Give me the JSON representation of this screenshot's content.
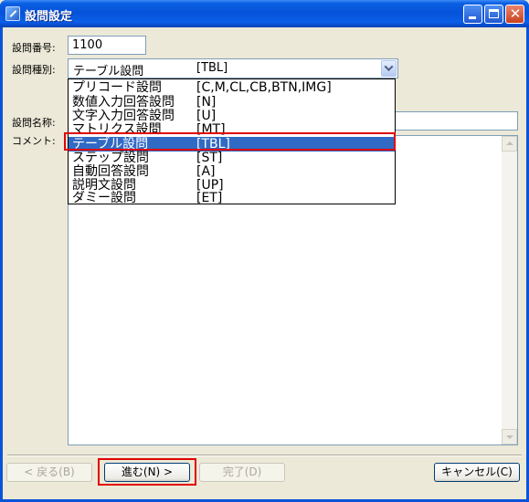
{
  "window": {
    "title": "設問設定",
    "icon": "pencil-app-icon",
    "controls": {
      "minimize": "minimize-icon",
      "maximize": "maximize-icon",
      "close": "✕"
    }
  },
  "form": {
    "number_label": "設問番号:",
    "number_value": "1100",
    "type_label": "設問種別:",
    "type_selected": "テーブル設問",
    "type_selected_code": "[TBL]",
    "name_label": "設問名称:",
    "comment_label": "コメント:"
  },
  "dropdown": {
    "options": [
      {
        "label": "プリコード設問",
        "code": "[C,M,CL,CB,BTN,IMG]"
      },
      {
        "label": "数値入力回答設問",
        "code": "[N]"
      },
      {
        "label": "文字入力回答設問",
        "code": "[U]"
      },
      {
        "label": "マトリクス設問",
        "code": "[MT]"
      },
      {
        "label": "テーブル設問",
        "code": "[TBL]"
      },
      {
        "label": "ステップ設問",
        "code": "[ST]"
      },
      {
        "label": "自動回答設問",
        "code": "[A]"
      },
      {
        "label": "説明文設問",
        "code": "[UP]"
      },
      {
        "label": "ダミー設問",
        "code": "[ET]"
      }
    ],
    "selected_index": 4
  },
  "buttons": {
    "back": "< 戻る(B)",
    "next": "進む(N) >",
    "finish": "完了(D)",
    "cancel": "キャンセル(C)"
  },
  "colors": {
    "selection": "#316ac5",
    "annotation_red": "#e00000",
    "titlebar": "#0653d9"
  }
}
